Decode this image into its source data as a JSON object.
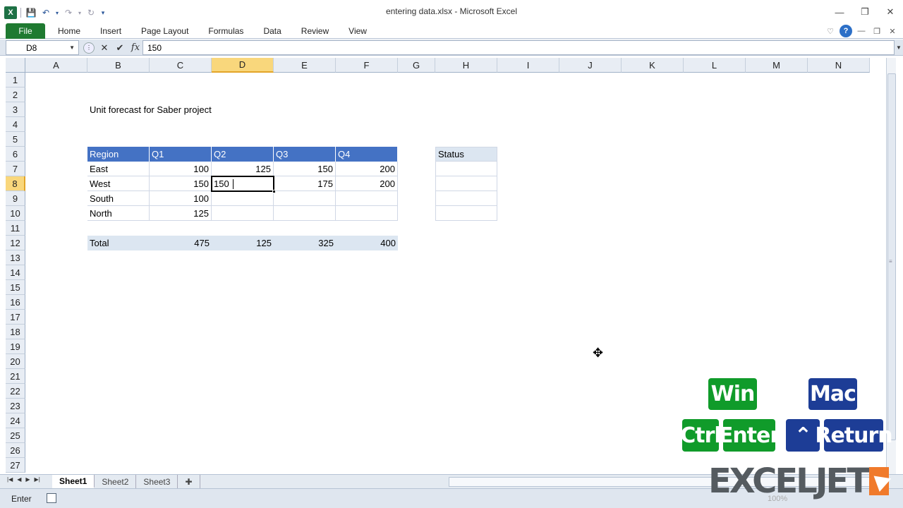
{
  "window": {
    "title": "entering data.xlsx - Microsoft Excel",
    "minimize": "—",
    "restore": "❐",
    "close": "✕"
  },
  "ribbon": {
    "tabs": [
      "File",
      "Home",
      "Insert",
      "Page Layout",
      "Formulas",
      "Data",
      "Review",
      "View"
    ]
  },
  "formula_bar": {
    "name_box": "D8",
    "fx": "fx",
    "value": "150"
  },
  "columns": [
    "A",
    "B",
    "C",
    "D",
    "E",
    "F",
    "G",
    "H",
    "I",
    "J",
    "K",
    "L",
    "M",
    "N"
  ],
  "rows": [
    "1",
    "2",
    "3",
    "4",
    "5",
    "6",
    "7",
    "8",
    "9",
    "10",
    "11",
    "12",
    "13",
    "14",
    "15",
    "16",
    "17",
    "18",
    "19",
    "20",
    "21",
    "22",
    "23",
    "24",
    "25",
    "26",
    "27"
  ],
  "sheet": {
    "title": "Unit forecast for Saber project",
    "headers": [
      "Region",
      "Q1",
      "Q2",
      "Q3",
      "Q4"
    ],
    "data_rows": [
      [
        "East",
        "100",
        "125",
        "150",
        "200"
      ],
      [
        "West",
        "150",
        "150",
        "175",
        "200"
      ],
      [
        "South",
        "100",
        "",
        "",
        ""
      ],
      [
        "North",
        "125",
        "",
        "",
        ""
      ]
    ],
    "total_row": [
      "Total",
      "475",
      "125",
      "325",
      "400"
    ],
    "status_header": "Status",
    "active_cell": "D8",
    "active_cell_value": "150"
  },
  "sheet_tabs": [
    "Sheet1",
    "Sheet2",
    "Sheet3"
  ],
  "status": {
    "mode": "Enter",
    "zoom": "100%"
  },
  "keyboard": {
    "win_label": "Win",
    "mac_label": "Mac",
    "win_keys": [
      "Ctrl",
      "Enter"
    ],
    "mac_keys": [
      "⌃",
      "Return"
    ]
  },
  "logo": {
    "text": "EXCELJET"
  }
}
